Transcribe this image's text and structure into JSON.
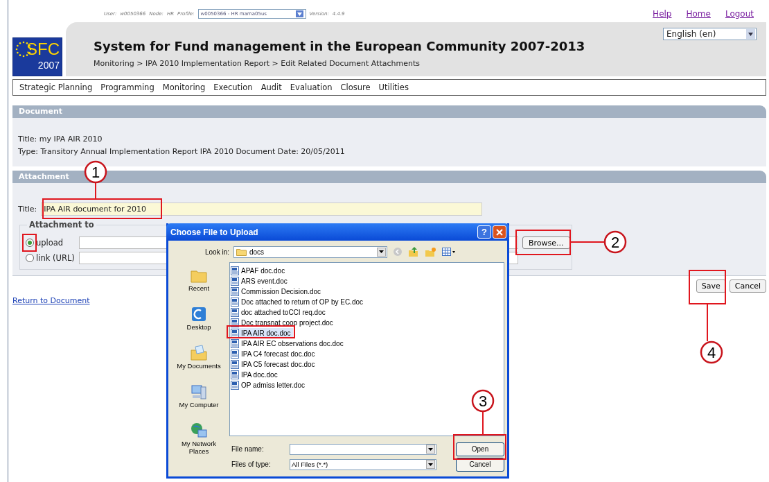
{
  "top_bar": {
    "user_label": "User:",
    "user": "w0050366",
    "node_label": "Node:",
    "node": "HR",
    "profile_label": "Profile:",
    "profile": "w0050366 - HR mama05us",
    "version_label": "Version:",
    "version": "4.4.9",
    "links": [
      "Help",
      "Home",
      "Logout"
    ]
  },
  "header": {
    "logo_text": "SFC",
    "logo_year": "2007",
    "title": "System for Fund management in the European Community 2007-2013",
    "breadcrumb": "Monitoring > IPA 2010 Implementation Report > Edit Related Document Attachments",
    "language": "English (en)"
  },
  "menu": [
    "Strategic Planning",
    "Programming",
    "Monitoring",
    "Execution",
    "Audit",
    "Evaluation",
    "Closure",
    "Utilities"
  ],
  "document": {
    "header": "Document",
    "title_line": "Title:  my IPA AIR 2010",
    "type_line": "Type: Transitory Annual Implementation Report IPA 2010 Document Date: 20/05/2011"
  },
  "attachment": {
    "header": "Attachment",
    "title_label": "Title:",
    "title_value": "IPA AIR document for 2010",
    "legend": "Attachment to",
    "options": [
      {
        "label": "upload",
        "selected": true
      },
      {
        "label": "link (URL)",
        "selected": false
      }
    ],
    "browse": "Browse..."
  },
  "actions": [
    "Save",
    "Cancel"
  ],
  "return_link": "Return to Document",
  "dialog": {
    "title": "Choose File to Upload",
    "help": "?",
    "look_in_label": "Look in:",
    "look_in": "docs",
    "places": [
      "Recent",
      "Desktop",
      "My Documents",
      "My Computer",
      "My Network Places"
    ],
    "files": [
      {
        "name": "APAF doc.doc",
        "selected": false
      },
      {
        "name": "ARS event.doc",
        "selected": false
      },
      {
        "name": "Commission Decision.doc",
        "selected": false
      },
      {
        "name": "Doc attached to return of OP by EC.doc",
        "selected": false
      },
      {
        "name": "doc attached toCCI req.doc",
        "selected": false
      },
      {
        "name": "Doc transnat coop project.doc",
        "selected": false
      },
      {
        "name": "IPA AIR doc.doc",
        "selected": true
      },
      {
        "name": "IPA AIR EC observations doc.doc",
        "selected": false
      },
      {
        "name": "IPA C4 forecast doc.doc",
        "selected": false
      },
      {
        "name": "IPA C5 forecast doc.doc",
        "selected": false
      },
      {
        "name": "IPA doc.doc",
        "selected": false
      },
      {
        "name": "OP admiss letter.doc",
        "selected": false
      }
    ],
    "file_name_label": "File name:",
    "file_type_label": "Files of type:",
    "file_type": "All Files (*.*)",
    "open": "Open",
    "cancel": "Cancel"
  },
  "callouts": [
    "1",
    "2",
    "3",
    "4"
  ]
}
